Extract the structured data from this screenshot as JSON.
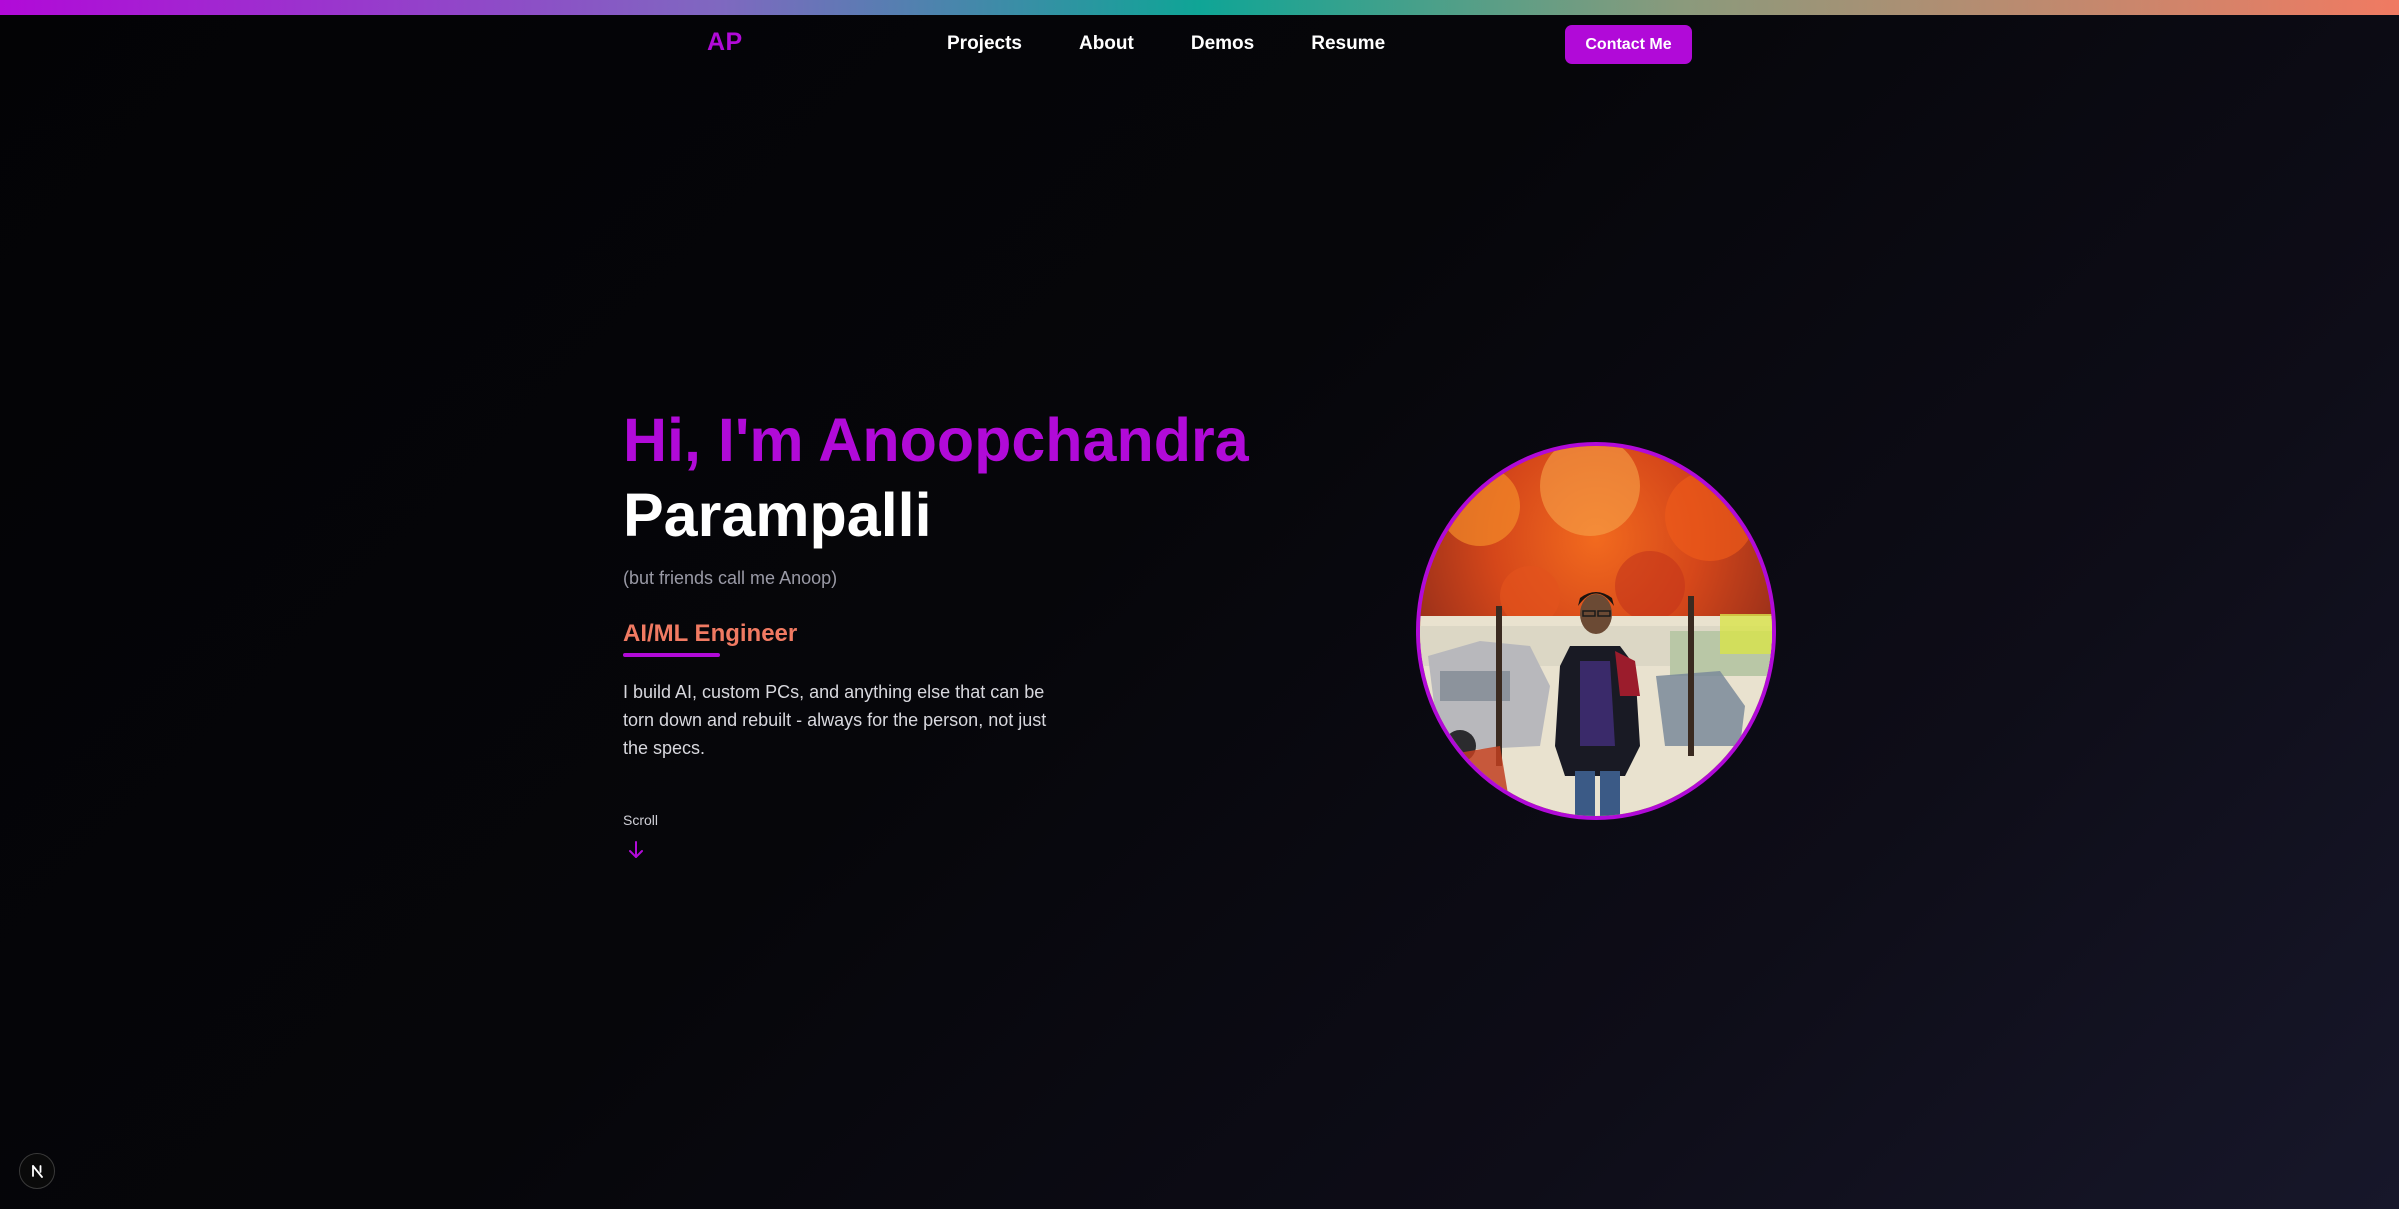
{
  "nav": {
    "logo": "AP",
    "links": [
      "Projects",
      "About",
      "Demos",
      "Resume"
    ],
    "contact_label": "Contact Me"
  },
  "hero": {
    "greeting_line1": "Hi, I'm Anoopchandra",
    "greeting_line2": "Parampalli",
    "nickname": "(but friends call me Anoop)",
    "role": "AI/ML Engineer",
    "bio": "I build AI, custom PCs, and anything else that can be torn down and rebuilt - always for the person, not just the specs.",
    "scroll_label": "Scroll",
    "scroll_icon": "arrow-down-icon",
    "photo_icon": "profile-photo"
  },
  "colors": {
    "accent": "#b10ad8",
    "role": "#f07a62",
    "background": "#050508",
    "text": "#ffffff",
    "muted": "#9a9aa6"
  },
  "badge": {
    "icon": "nextjs-icon"
  }
}
